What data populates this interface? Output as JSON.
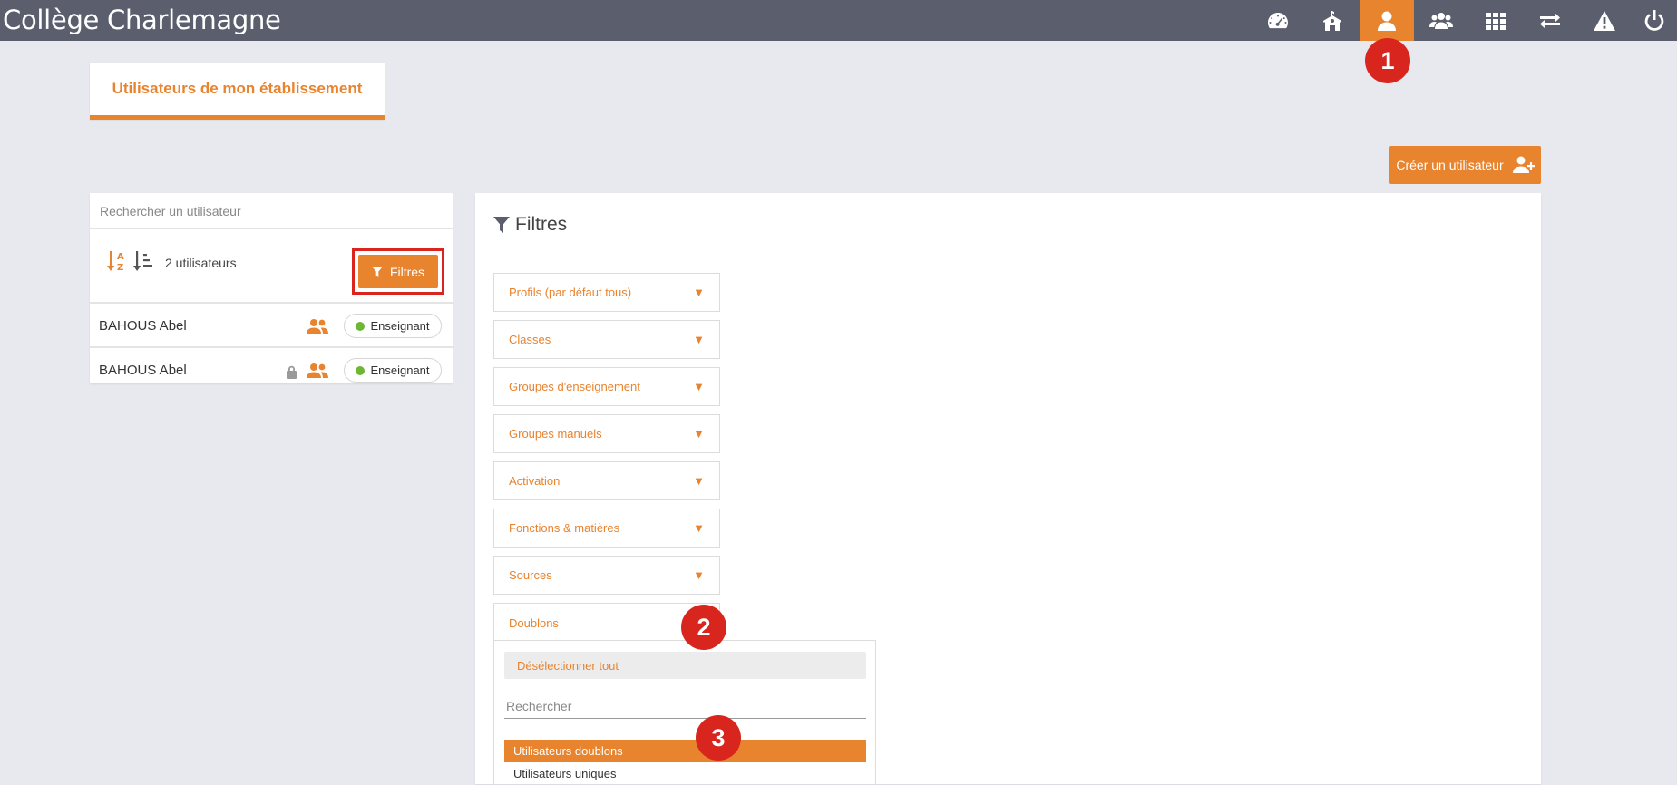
{
  "app": {
    "title": "Collège Charlemagne"
  },
  "nav": {
    "icons": [
      "dashboard-icon",
      "school-icon",
      "user-icon",
      "group-icon",
      "apps-grid-icon",
      "transfer-icon",
      "alert-icon",
      "power-icon"
    ],
    "active": "user-icon"
  },
  "markers": {
    "m1": "1",
    "m2": "2",
    "m3": "3"
  },
  "tab": {
    "label": "Utilisateurs de mon établissement"
  },
  "actions": {
    "create_user": "Créer un utilisateur"
  },
  "search": {
    "placeholder": "Rechercher un utilisateur"
  },
  "list": {
    "count_label": "2 utilisateurs",
    "filter_button": "Filtres",
    "users": [
      {
        "name": "BAHOUS Abel",
        "role": "Enseignant",
        "locked": false
      },
      {
        "name": "BAHOUS Abel",
        "role": "Enseignant",
        "locked": true
      }
    ]
  },
  "filters": {
    "title": "Filtres",
    "sections": [
      "Profils (par défaut tous)",
      "Classes",
      "Groupes d'enseignement",
      "Groupes manuels",
      "Activation",
      "Fonctions & matières",
      "Sources"
    ],
    "open_section": "Doublons",
    "dropdown": {
      "deselect_all": "Désélectionner tout",
      "search_placeholder": "Rechercher",
      "options": [
        {
          "label": "Utilisateurs doublons",
          "selected": true
        },
        {
          "label": "Utilisateurs uniques",
          "selected": false
        }
      ]
    }
  },
  "colors": {
    "accent": "#e8832e",
    "topbar": "#5b5f6d",
    "marker": "#d8261f",
    "active_dot": "#6fb634"
  }
}
